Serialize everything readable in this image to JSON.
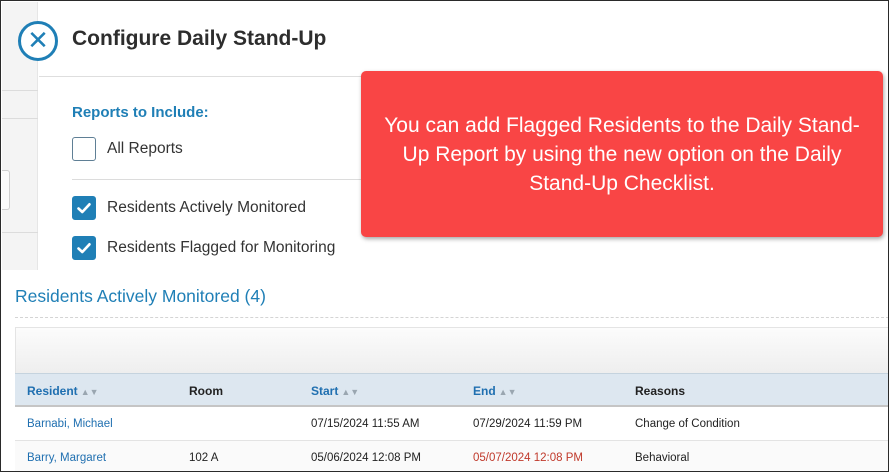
{
  "modal": {
    "title": "Configure Daily Stand-Up",
    "close_icon": "close-icon",
    "section_heading": "Reports to Include:",
    "options": [
      {
        "label": "All Reports",
        "checked": false
      },
      {
        "label": "Residents Actively Monitored",
        "checked": true
      },
      {
        "label": "Residents Flagged for Monitoring",
        "checked": true
      }
    ]
  },
  "callout": {
    "text": "You can add Flagged Residents to the Daily Stand-Up Report by using the new option on the Daily Stand-Up Checklist.",
    "color": "#f94545"
  },
  "list": {
    "title": "Residents Actively Monitored (4)"
  },
  "table": {
    "columns": [
      {
        "label": "Resident",
        "sortable": true
      },
      {
        "label": "Room",
        "sortable": false
      },
      {
        "label": "Start",
        "sortable": true
      },
      {
        "label": "End",
        "sortable": true
      },
      {
        "label": "Reasons",
        "sortable": false
      }
    ],
    "rows": [
      {
        "resident": "Barnabi, Michael",
        "room": "",
        "start": "07/15/2024 11:55 AM",
        "end": "07/29/2024 11:59 PM",
        "end_overdue": false,
        "reasons": "Change of Condition"
      },
      {
        "resident": "Barry, Margaret",
        "room": "102 A",
        "start": "05/06/2024 12:08 PM",
        "end": "05/07/2024 12:08 PM",
        "end_overdue": true,
        "reasons": "Behavioral"
      }
    ]
  },
  "colors": {
    "accent": "#1f7fb6",
    "overdue": "#c0392b"
  }
}
